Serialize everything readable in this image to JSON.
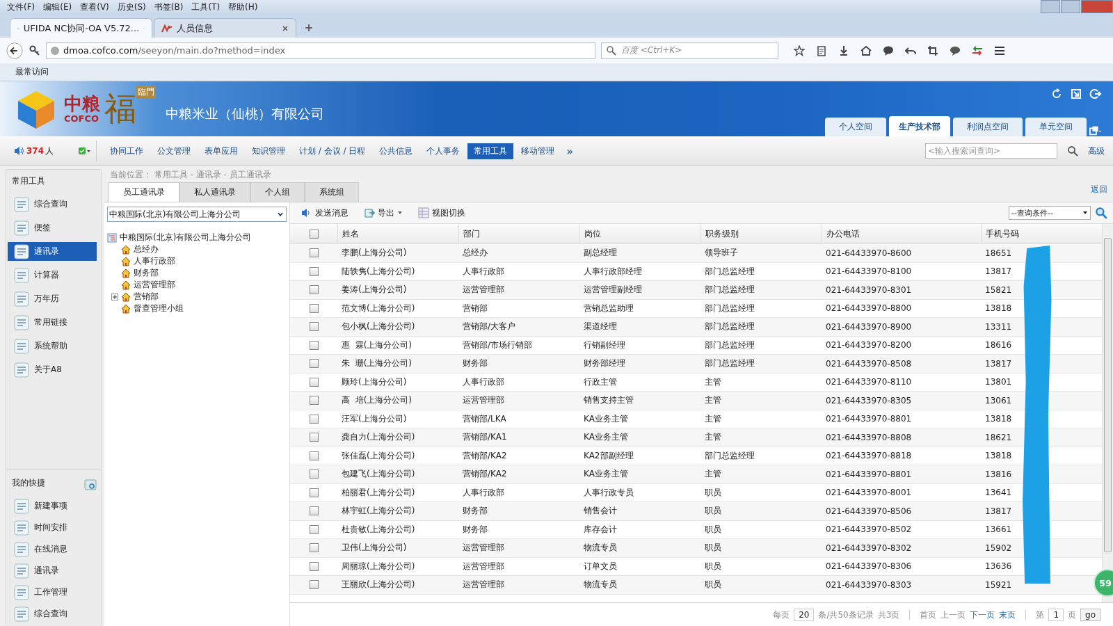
{
  "browser": {
    "menu": [
      "文件(F)",
      "编辑(E)",
      "查看(V)",
      "历史(S)",
      "书签(B)",
      "工具(T)",
      "帮助(H)"
    ],
    "tabs": [
      {
        "title": "UFIDA NC协同-OA V5.72...",
        "selected": true
      },
      {
        "title": "人员信息",
        "selected": false
      }
    ],
    "url_host": "dmoa.cofco.com",
    "url_path": "/seeyon/main.do?method=index",
    "search_placeholder": "百度 <Ctrl+K>",
    "bookmark": "最常访问"
  },
  "header": {
    "logo_cn": "中粮",
    "logo_en": "COFCO",
    "logo_fu": "福",
    "logo_lm": "臨門",
    "company": "中粮米业（仙桃）有限公司",
    "space_tabs": [
      {
        "label": "个人空间",
        "selected": false
      },
      {
        "label": "生产技术部",
        "selected": true
      },
      {
        "label": "利润点空间",
        "selected": false
      },
      {
        "label": "单元空间",
        "selected": false
      }
    ]
  },
  "nav": {
    "online_count": "374",
    "online_unit": "人",
    "items": [
      {
        "label": "协同工作",
        "selected": false
      },
      {
        "label": "公文管理",
        "selected": false
      },
      {
        "label": "表单应用",
        "selected": false
      },
      {
        "label": "知识管理",
        "selected": false
      },
      {
        "label": "计划 / 会议 / 日程",
        "selected": false
      },
      {
        "label": "公共信息",
        "selected": false
      },
      {
        "label": "个人事务",
        "selected": false
      },
      {
        "label": "常用工具",
        "selected": true
      },
      {
        "label": "移动管理",
        "selected": false
      }
    ],
    "more": "»",
    "search_placeholder": "<输入搜索词查询>",
    "advanced": "高级"
  },
  "breadcrumb": "当前位置： 常用工具 - 通讯录 - 员工通讯录",
  "sidebar": {
    "title": "常用工具",
    "items": [
      {
        "label": "综合查询",
        "selected": false
      },
      {
        "label": "便签",
        "selected": false
      },
      {
        "label": "通讯录",
        "selected": true
      },
      {
        "label": "计算器",
        "selected": false
      },
      {
        "label": "万年历",
        "selected": false
      },
      {
        "label": "常用链接",
        "selected": false
      },
      {
        "label": "系统帮助",
        "selected": false
      },
      {
        "label": "关于A8",
        "selected": false
      }
    ],
    "shortcuts_title": "我的快捷",
    "shortcuts": [
      "新建事项",
      "时间安排",
      "在线消息",
      "通讯录",
      "工作管理",
      "综合查询"
    ]
  },
  "book_tabs": [
    {
      "label": "员工通讯录",
      "selected": true
    },
    {
      "label": "私人通讯录",
      "selected": false
    },
    {
      "label": "个人组",
      "selected": false
    },
    {
      "label": "系统组",
      "selected": false
    }
  ],
  "back": "返回",
  "org_select": "中粮国际(北京)有限公司上海分公司",
  "tree": {
    "label": "中粮国际(北京)有限公司上海分公司",
    "children": [
      {
        "label": "总经办",
        "collapsed": false
      },
      {
        "label": "人事行政部",
        "collapsed": false
      },
      {
        "label": "财务部",
        "collapsed": false
      },
      {
        "label": "运营管理部",
        "collapsed": false
      },
      {
        "label": "营销部",
        "collapsed": true
      },
      {
        "label": "督查管理小组",
        "collapsed": false
      }
    ]
  },
  "toolbar": [
    "发送消息",
    "导出",
    "视图切换"
  ],
  "query_select": "--查询条件--",
  "table": {
    "columns": [
      "姓名",
      "部门",
      "岗位",
      "职务级别",
      "办公电话",
      "手机号码"
    ],
    "header_checked": false,
    "rows": [
      {
        "checked": false,
        "cells": [
          "李鹏(上海分公司)",
          "总经办",
          "副总经理",
          "领导班子",
          "021-64433970-8600",
          "18651"
        ]
      },
      {
        "checked": false,
        "cells": [
          "陆轶隽(上海分公司)",
          "人事行政部",
          "人事行政部经理",
          "部门总监经理",
          "021-64433970-8100",
          "13817"
        ]
      },
      {
        "checked": false,
        "cells": [
          "姜涛(上海分公司)",
          "运营管理部",
          "运营管理副经理",
          "部门总监经理",
          "021-64433970-8301",
          "15821"
        ]
      },
      {
        "checked": false,
        "cells": [
          "范文博(上海分公司)",
          "营销部",
          "营销总监助理",
          "部门总监经理",
          "021-64433970-8800",
          "13818"
        ]
      },
      {
        "checked": false,
        "cells": [
          "包小枫(上海分公司)",
          "营销部/大客户",
          "渠道经理",
          "部门总监经理",
          "021-64433970-8900",
          "13311"
        ]
      },
      {
        "checked": false,
        "cells": [
          "惠  霖(上海分公司)",
          "营销部/市场行销部",
          "行销副经理",
          "部门总监经理",
          "021-64433970-8200",
          "18616"
        ]
      },
      {
        "checked": false,
        "cells": [
          "朱  珊(上海分公司)",
          "财务部",
          "财务部经理",
          "部门总监经理",
          "021-64433970-8508",
          "13817"
        ]
      },
      {
        "checked": false,
        "cells": [
          "顾玲(上海分公司)",
          "人事行政部",
          "行政主管",
          "主管",
          "021-64433970-8110",
          "13801"
        ]
      },
      {
        "checked": false,
        "cells": [
          "高  培(上海分公司)",
          "运营管理部",
          "销售支持主管",
          "主管",
          "021-64433970-8305",
          "13061"
        ]
      },
      {
        "checked": false,
        "cells": [
          "汪军(上海分公司)",
          "营销部/LKA",
          "KA业务主管",
          "主管",
          "021-64433970-8801",
          "13818"
        ]
      },
      {
        "checked": false,
        "cells": [
          "龚自力(上海分公司)",
          "营销部/KA1",
          "KA业务主管",
          "主管",
          "021-64433970-8808",
          "18621"
        ]
      },
      {
        "checked": false,
        "cells": [
          "张佳磊(上海分公司)",
          "营销部/KA2",
          "KA2部副经理",
          "部门总监经理",
          "021-64433970-8818",
          "13818"
        ]
      },
      {
        "checked": false,
        "cells": [
          "包建飞(上海分公司)",
          "营销部/KA2",
          "KA业务主管",
          "主管",
          "021-64433970-8801",
          "13816"
        ]
      },
      {
        "checked": false,
        "cells": [
          "柏丽君(上海分公司)",
          "人事行政部",
          "人事行政专员",
          "职员",
          "021-64433970-8001",
          "13641"
        ]
      },
      {
        "checked": false,
        "cells": [
          "林宇虹(上海分公司)",
          "财务部",
          "销售会计",
          "职员",
          "021-64433970-8506",
          "13817"
        ]
      },
      {
        "checked": false,
        "cells": [
          "杜贵敏(上海分公司)",
          "财务部",
          "库存会计",
          "职员",
          "021-64433970-8502",
          "13661"
        ]
      },
      {
        "checked": false,
        "cells": [
          "卫伟(上海分公司)",
          "运营管理部",
          "物流专员",
          "职员",
          "021-64433970-8302",
          "15902"
        ]
      },
      {
        "checked": false,
        "cells": [
          "周丽琼(上海分公司)",
          "运营管理部",
          "订单文员",
          "职员",
          "021-64433970-8306",
          "13636"
        ]
      },
      {
        "checked": false,
        "cells": [
          "王丽欣(上海分公司)",
          "运营管理部",
          "物流专员",
          "职员",
          "021-64433970-8303",
          "15921"
        ]
      }
    ]
  },
  "pager": {
    "per_page_label": "每页",
    "per_page": "20",
    "records": "条/共50条记录",
    "pages": "共3页",
    "first": "首页",
    "prev": "上一页",
    "next": "下一页",
    "last": "末页",
    "page_label": "第",
    "page": "1",
    "page_unit": "页",
    "go": "go"
  },
  "badge": "59"
}
